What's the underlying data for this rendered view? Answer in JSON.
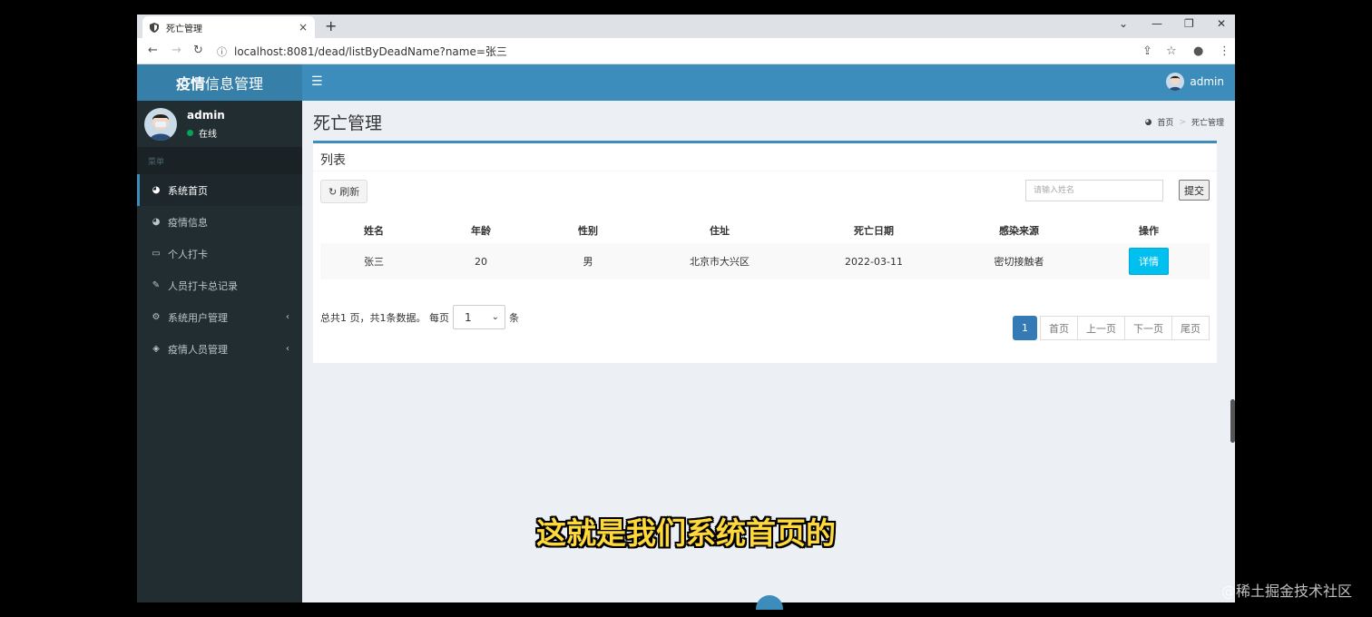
{
  "browser": {
    "tab_title": "死亡管理",
    "url": "localhost:8081/dead/listByDeadName?name=张三"
  },
  "app": {
    "logo_bold": "疫情",
    "logo_rest": "信息管理",
    "user": {
      "name": "admin",
      "status": "在线"
    },
    "menu_header": "菜单",
    "menu": [
      {
        "label": "系统首页",
        "icon": "dashboard-icon"
      },
      {
        "label": "疫情信息",
        "icon": "dashboard-icon"
      },
      {
        "label": "个人打卡",
        "icon": "laptop-icon"
      },
      {
        "label": "人员打卡总记录",
        "icon": "edit-icon"
      },
      {
        "label": "系统用户管理",
        "icon": "cogs-icon",
        "arrow": "‹"
      },
      {
        "label": "疫情人员管理",
        "icon": "cube-icon",
        "arrow": "‹"
      }
    ],
    "top_user": "admin",
    "page_title": "死亡管理",
    "breadcrumb": {
      "home": "首页",
      "current": "死亡管理"
    },
    "box_title": "列表",
    "refresh_label": "刷新",
    "search_placeholder": "请输入姓名",
    "submit_label": "提交",
    "table": {
      "headers": [
        "姓名",
        "年龄",
        "性别",
        "住址",
        "死亡日期",
        "感染来源",
        "操作"
      ],
      "rows": [
        {
          "name": "张三",
          "age": "20",
          "gender": "男",
          "address": "北京市大兴区",
          "date": "2022-03-11",
          "source": "密切接触者",
          "action": "详情"
        }
      ]
    },
    "page_info_prefix": "总共1 页，共1条数据。 每页",
    "page_size": "1",
    "page_info_suffix": "条",
    "pagination": {
      "current": "1",
      "first": "首页",
      "prev": "上一页",
      "next": "下一页",
      "last": "尾页"
    }
  },
  "overlay": {
    "subtitle": "这就是我们系统首页的",
    "watermark": "@稀土掘金技术社区"
  },
  "colors": {
    "primary": "#3c8dbc",
    "sidebar": "#222d32",
    "detail_button": "#00c0ef",
    "subtitle": "#ffd83a"
  }
}
